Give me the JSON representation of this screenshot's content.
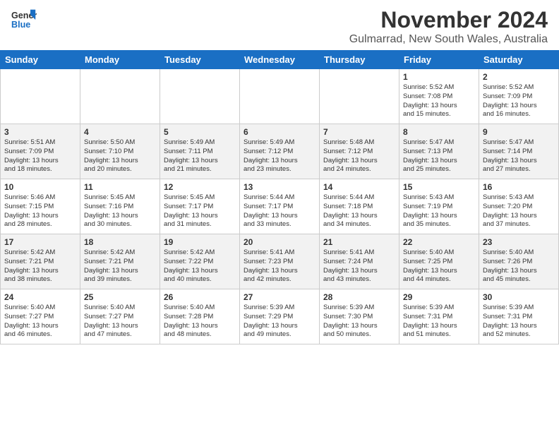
{
  "logo": {
    "text_general": "General",
    "text_blue": "Blue"
  },
  "title": "November 2024",
  "subtitle": "Gulmarrad, New South Wales, Australia",
  "weekdays": [
    "Sunday",
    "Monday",
    "Tuesday",
    "Wednesday",
    "Thursday",
    "Friday",
    "Saturday"
  ],
  "weeks": [
    [
      {
        "day": "",
        "info": ""
      },
      {
        "day": "",
        "info": ""
      },
      {
        "day": "",
        "info": ""
      },
      {
        "day": "",
        "info": ""
      },
      {
        "day": "",
        "info": ""
      },
      {
        "day": "1",
        "info": "Sunrise: 5:52 AM\nSunset: 7:08 PM\nDaylight: 13 hours\nand 15 minutes."
      },
      {
        "day": "2",
        "info": "Sunrise: 5:52 AM\nSunset: 7:09 PM\nDaylight: 13 hours\nand 16 minutes."
      }
    ],
    [
      {
        "day": "3",
        "info": "Sunrise: 5:51 AM\nSunset: 7:09 PM\nDaylight: 13 hours\nand 18 minutes."
      },
      {
        "day": "4",
        "info": "Sunrise: 5:50 AM\nSunset: 7:10 PM\nDaylight: 13 hours\nand 20 minutes."
      },
      {
        "day": "5",
        "info": "Sunrise: 5:49 AM\nSunset: 7:11 PM\nDaylight: 13 hours\nand 21 minutes."
      },
      {
        "day": "6",
        "info": "Sunrise: 5:49 AM\nSunset: 7:12 PM\nDaylight: 13 hours\nand 23 minutes."
      },
      {
        "day": "7",
        "info": "Sunrise: 5:48 AM\nSunset: 7:12 PM\nDaylight: 13 hours\nand 24 minutes."
      },
      {
        "day": "8",
        "info": "Sunrise: 5:47 AM\nSunset: 7:13 PM\nDaylight: 13 hours\nand 25 minutes."
      },
      {
        "day": "9",
        "info": "Sunrise: 5:47 AM\nSunset: 7:14 PM\nDaylight: 13 hours\nand 27 minutes."
      }
    ],
    [
      {
        "day": "10",
        "info": "Sunrise: 5:46 AM\nSunset: 7:15 PM\nDaylight: 13 hours\nand 28 minutes."
      },
      {
        "day": "11",
        "info": "Sunrise: 5:45 AM\nSunset: 7:16 PM\nDaylight: 13 hours\nand 30 minutes."
      },
      {
        "day": "12",
        "info": "Sunrise: 5:45 AM\nSunset: 7:17 PM\nDaylight: 13 hours\nand 31 minutes."
      },
      {
        "day": "13",
        "info": "Sunrise: 5:44 AM\nSunset: 7:17 PM\nDaylight: 13 hours\nand 33 minutes."
      },
      {
        "day": "14",
        "info": "Sunrise: 5:44 AM\nSunset: 7:18 PM\nDaylight: 13 hours\nand 34 minutes."
      },
      {
        "day": "15",
        "info": "Sunrise: 5:43 AM\nSunset: 7:19 PM\nDaylight: 13 hours\nand 35 minutes."
      },
      {
        "day": "16",
        "info": "Sunrise: 5:43 AM\nSunset: 7:20 PM\nDaylight: 13 hours\nand 37 minutes."
      }
    ],
    [
      {
        "day": "17",
        "info": "Sunrise: 5:42 AM\nSunset: 7:21 PM\nDaylight: 13 hours\nand 38 minutes."
      },
      {
        "day": "18",
        "info": "Sunrise: 5:42 AM\nSunset: 7:21 PM\nDaylight: 13 hours\nand 39 minutes."
      },
      {
        "day": "19",
        "info": "Sunrise: 5:42 AM\nSunset: 7:22 PM\nDaylight: 13 hours\nand 40 minutes."
      },
      {
        "day": "20",
        "info": "Sunrise: 5:41 AM\nSunset: 7:23 PM\nDaylight: 13 hours\nand 42 minutes."
      },
      {
        "day": "21",
        "info": "Sunrise: 5:41 AM\nSunset: 7:24 PM\nDaylight: 13 hours\nand 43 minutes."
      },
      {
        "day": "22",
        "info": "Sunrise: 5:40 AM\nSunset: 7:25 PM\nDaylight: 13 hours\nand 44 minutes."
      },
      {
        "day": "23",
        "info": "Sunrise: 5:40 AM\nSunset: 7:26 PM\nDaylight: 13 hours\nand 45 minutes."
      }
    ],
    [
      {
        "day": "24",
        "info": "Sunrise: 5:40 AM\nSunset: 7:27 PM\nDaylight: 13 hours\nand 46 minutes."
      },
      {
        "day": "25",
        "info": "Sunrise: 5:40 AM\nSunset: 7:27 PM\nDaylight: 13 hours\nand 47 minutes."
      },
      {
        "day": "26",
        "info": "Sunrise: 5:40 AM\nSunset: 7:28 PM\nDaylight: 13 hours\nand 48 minutes."
      },
      {
        "day": "27",
        "info": "Sunrise: 5:39 AM\nSunset: 7:29 PM\nDaylight: 13 hours\nand 49 minutes."
      },
      {
        "day": "28",
        "info": "Sunrise: 5:39 AM\nSunset: 7:30 PM\nDaylight: 13 hours\nand 50 minutes."
      },
      {
        "day": "29",
        "info": "Sunrise: 5:39 AM\nSunset: 7:31 PM\nDaylight: 13 hours\nand 51 minutes."
      },
      {
        "day": "30",
        "info": "Sunrise: 5:39 AM\nSunset: 7:31 PM\nDaylight: 13 hours\nand 52 minutes."
      }
    ]
  ]
}
